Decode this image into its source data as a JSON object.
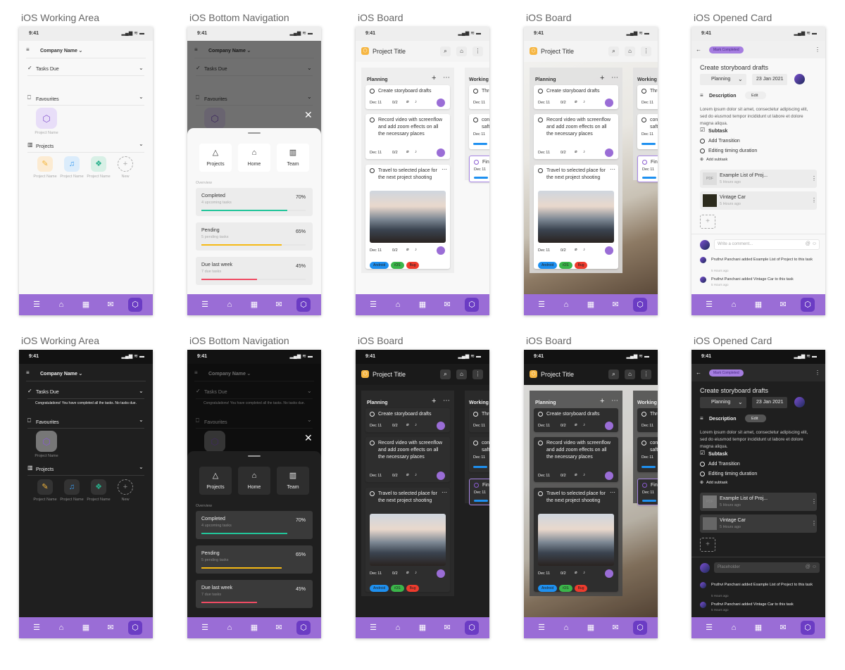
{
  "screen_titles": [
    "iOS Working Area",
    "iOS Bottom Navigation",
    "iOS Board",
    "iOS Board",
    "iOS Opened Card",
    "iOS Working Area",
    "iOS Bottom Navigation",
    "iOS Board",
    "iOS Board",
    "iOS Opened Card"
  ],
  "status": {
    "time": "9:41"
  },
  "working": {
    "company": "Company Name",
    "tasks_due": "Tasks Due",
    "congrats": "Congratulations! You have completed all the tasks. No tasks due.",
    "favourites": "Favourites",
    "fav_item": "Project Name",
    "projects_label": "Projects",
    "projects": [
      {
        "label": "Project Name",
        "icon": "feather-icon",
        "color": "#f4b63c",
        "bg": "#fcebd2"
      },
      {
        "label": "Project Name",
        "icon": "music-icon",
        "color": "#3b9bf0",
        "bg": "#dbecfb"
      },
      {
        "label": "Project Name",
        "icon": "cube-outline-icon",
        "color": "#27b08b",
        "bg": "#d8f0e6"
      }
    ],
    "new_label": "New"
  },
  "sheet": {
    "tiles": [
      {
        "label": "Projects",
        "icon": "triangle-icon",
        "glyph": "△"
      },
      {
        "label": "Home",
        "icon": "home-icon",
        "glyph": "⌂"
      },
      {
        "label": "Team",
        "icon": "briefcase-icon",
        "glyph": "▥"
      }
    ],
    "overview": "Overview",
    "stats": [
      {
        "label": "Completed",
        "sub": "4 upcoming tasks",
        "pct": "70%",
        "value": 70,
        "color": "#22c59a"
      },
      {
        "label": "Pending",
        "sub": "5 pending tasks",
        "pct": "65%",
        "value": 65,
        "color": "#f5b914"
      },
      {
        "label": "Due last week",
        "sub": "7 due tasks",
        "pct": "45%",
        "value": 45,
        "color": "#ef4b63"
      }
    ]
  },
  "board": {
    "title": "Project Title",
    "columns": [
      {
        "name": "Planning",
        "cards": [
          {
            "title": "Create storyboard drafts",
            "date": "Dec 11",
            "count": "0/2"
          },
          {
            "title": "Record video with screenflow and add zoom effects on all the necessary places",
            "date": "Dec 11",
            "count": "0/2"
          },
          {
            "title": "Travel to selected place for the next project shooting",
            "date": "Dec 11",
            "count": "0/2",
            "tags": [
              {
                "label": "Android",
                "color": "#1e90f0"
              },
              {
                "label": "iOS",
                "color": "#3bb64a"
              },
              {
                "label": "Bug",
                "color": "#ee3b2d"
              }
            ]
          }
        ]
      },
      {
        "name": "Working",
        "cards": [
          {
            "title": "Thro",
            "date": "Dec 11"
          },
          {
            "title": "con saft",
            "date": "Dec 11"
          },
          {
            "title": "Finis",
            "date": "Dec 11"
          }
        ]
      }
    ]
  },
  "card": {
    "mark_completed": "Mark Completed",
    "title": "Create storyboard drafts",
    "status": "Planning",
    "date": "23 Jan 2021",
    "description_label": "Description",
    "edit": "Edit",
    "description": "Lorem ipsum dolor sit amet, consectetur adipiscing elit, sed do eiusmod tempor incididunt ut labore et dolore magna aliqua.",
    "subtask_label": "Subtask",
    "subtasks": [
      "Add Transition",
      "Editing timing duration"
    ],
    "add_subtask": "Add subtask",
    "attachments": [
      {
        "name": "Example List of Proj...",
        "time": "5 Hours ago",
        "thumb": "PDF"
      },
      {
        "name": "Vintage Car",
        "time": "5 Hours ago",
        "thumb": ""
      }
    ],
    "comment_placeholder_light": "Write a comment...",
    "comment_placeholder_dark": "Placeholder",
    "activity": [
      {
        "text": "Pruthvi Panchani added Example List of Project to this task",
        "time": "5 Hours ago"
      },
      {
        "text": "Pruthvi Panchani added Vintage Car to this task",
        "time": "5 Hours ago"
      }
    ]
  },
  "nav": {
    "icons": [
      "menu-icon",
      "home-icon",
      "calendar-icon",
      "mail-icon",
      "cube-icon"
    ],
    "accent": "#9a6dd6",
    "active": "#6b3cc4"
  }
}
